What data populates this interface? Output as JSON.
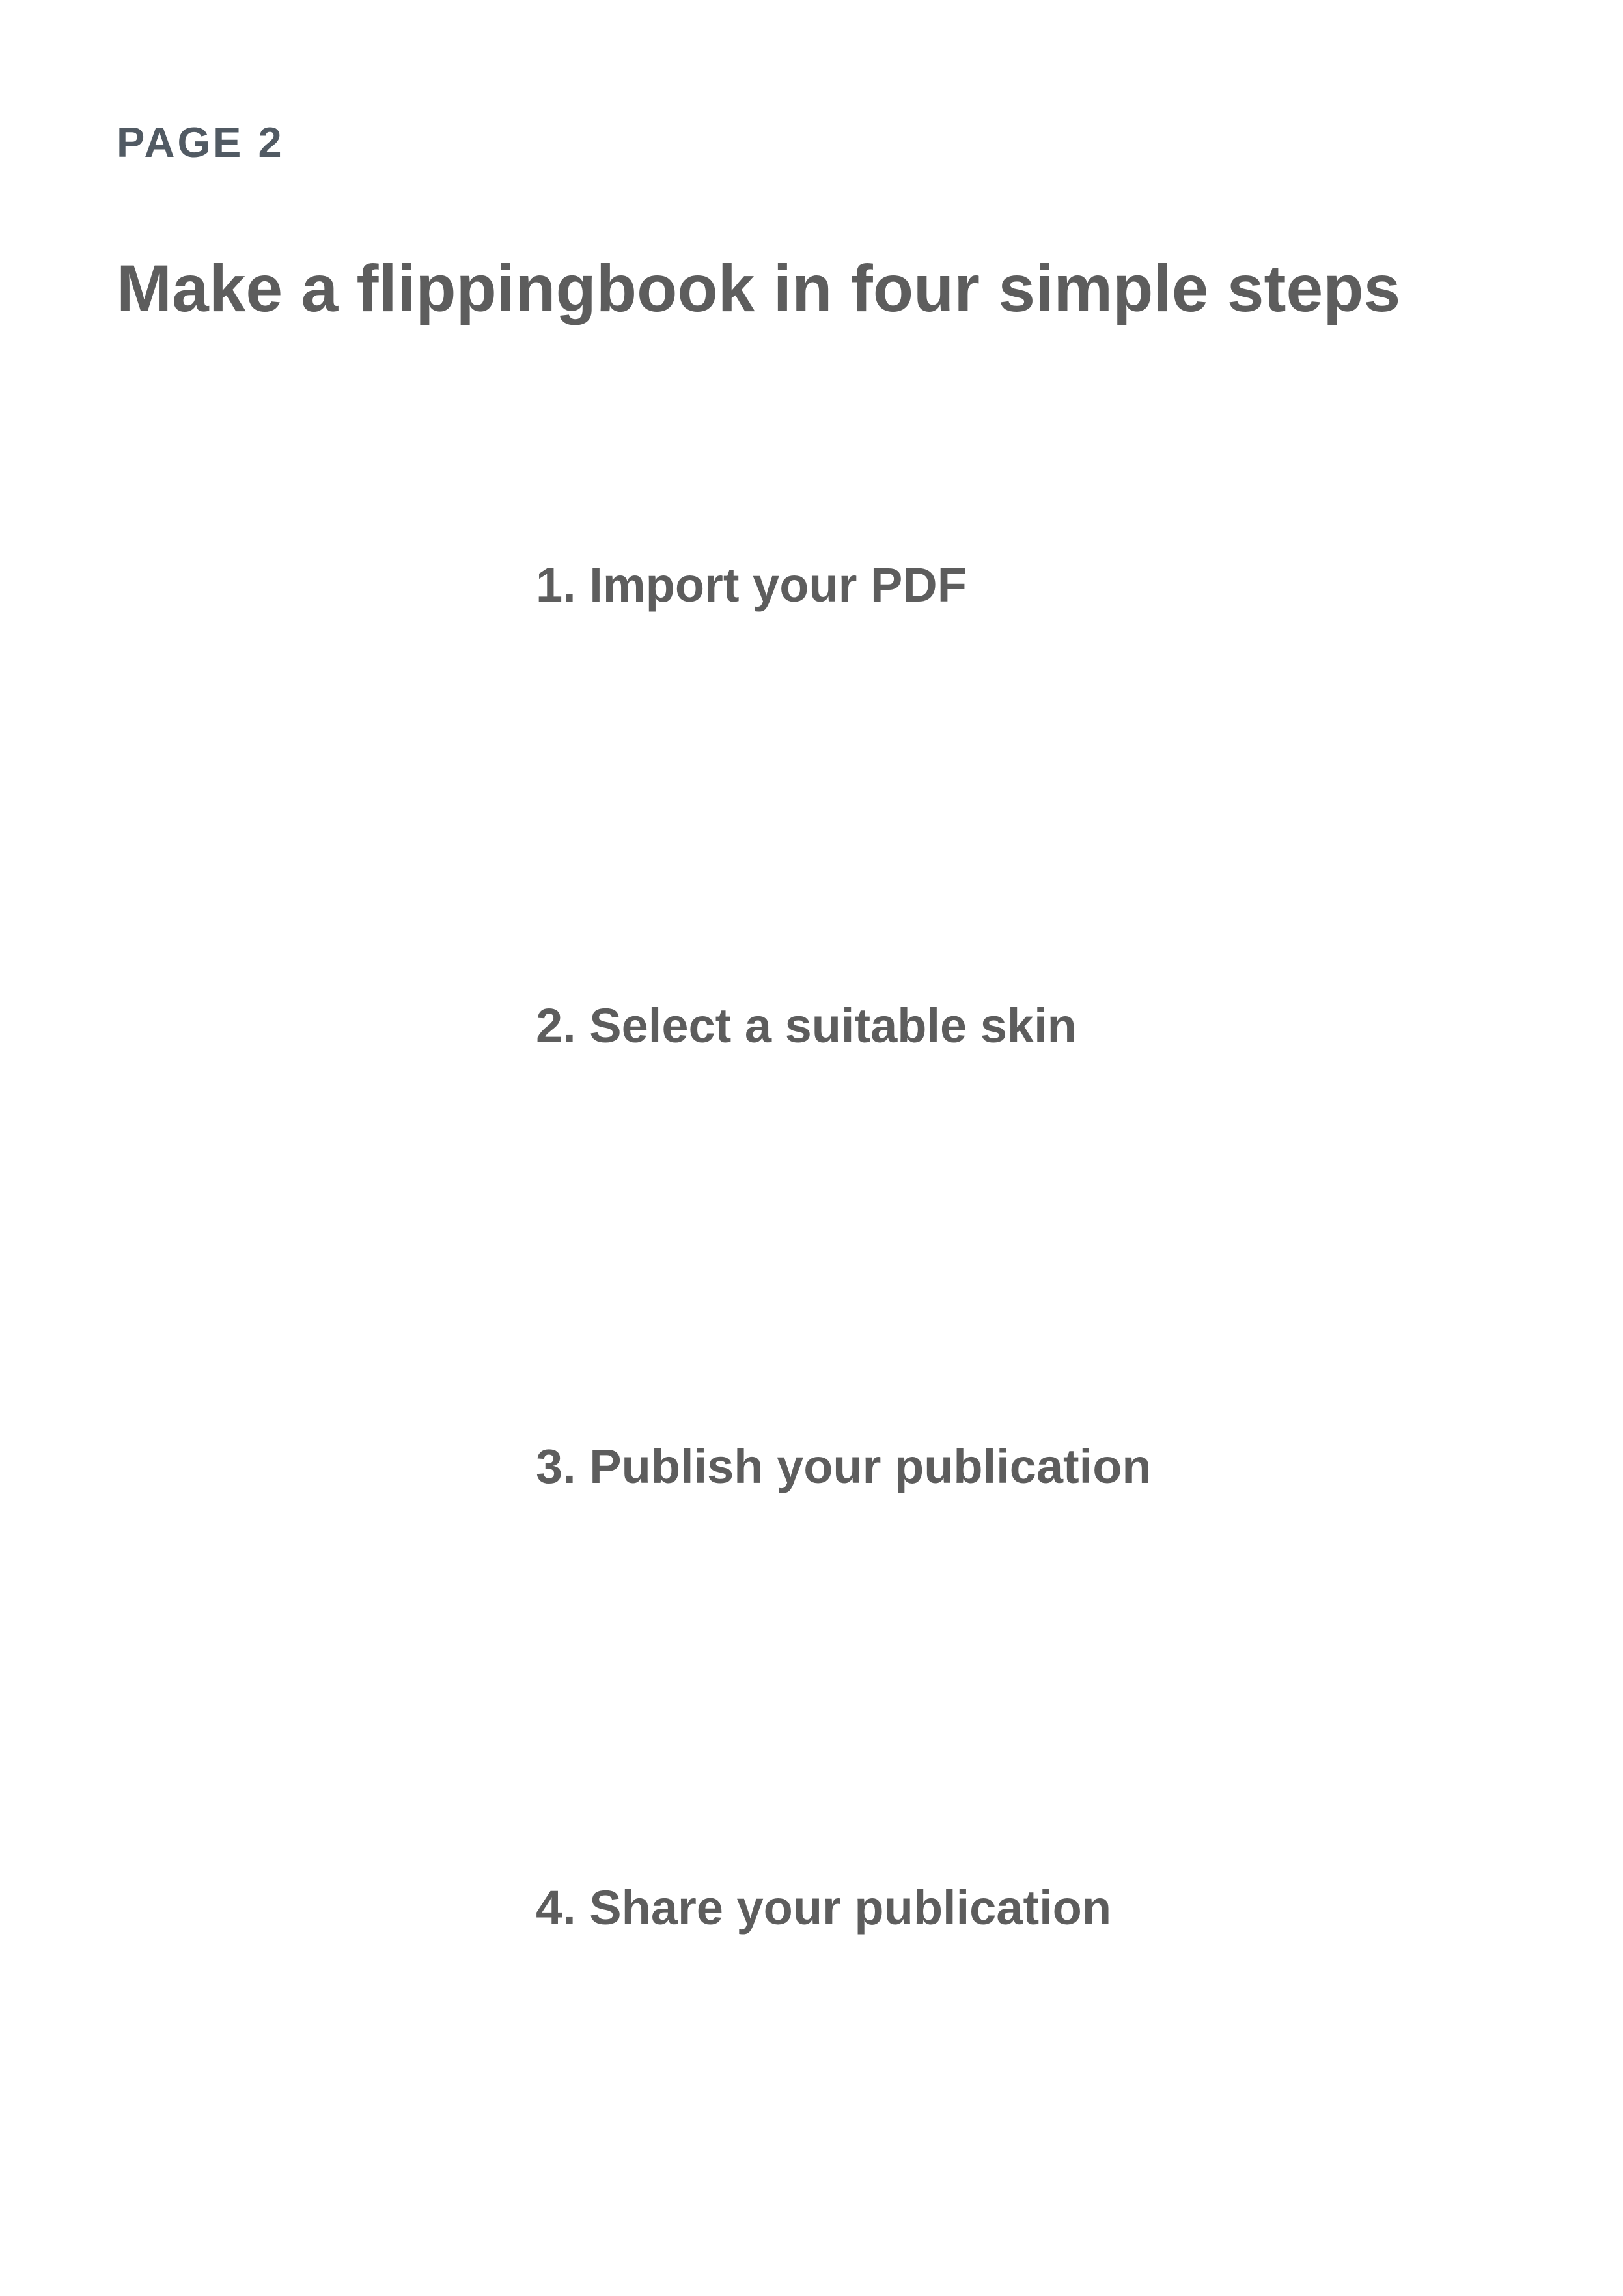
{
  "page": {
    "label": "PAGE 2",
    "title": "Make a flippingbook in four simple steps"
  },
  "steps": [
    {
      "label": "1. Import your PDF"
    },
    {
      "label": "2. Select a suitable skin"
    },
    {
      "label": "3. Publish your publication"
    },
    {
      "label": "4. Share your publication"
    }
  ]
}
